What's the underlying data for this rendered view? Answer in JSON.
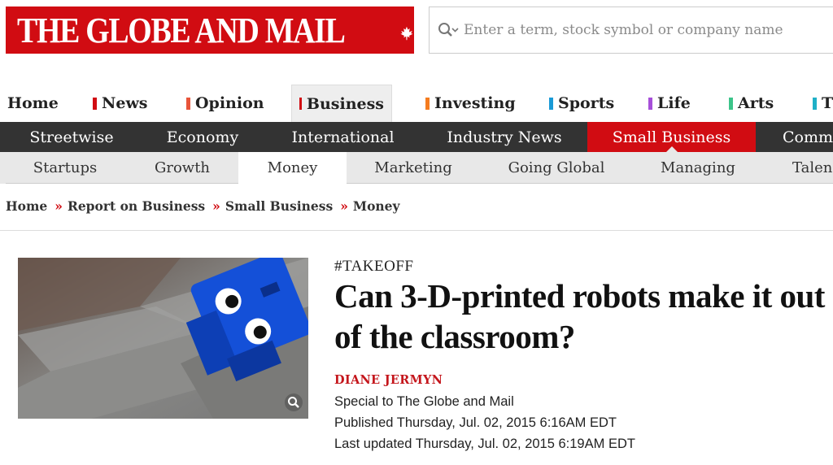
{
  "header": {
    "logo_text": "THE GLOBE AND MAIL",
    "search_placeholder": "Enter a term, stock symbol or company name"
  },
  "primary_nav": [
    {
      "label": "Home",
      "color": ""
    },
    {
      "label": "News",
      "color": "#d10c12"
    },
    {
      "label": "Opinion",
      "color": "#e8543a"
    },
    {
      "label": "Business",
      "color": "#d10c12"
    },
    {
      "label": "Investing",
      "color": "#f57c1f"
    },
    {
      "label": "Sports",
      "color": "#1a9ad6"
    },
    {
      "label": "Life",
      "color": "#a64fd9"
    },
    {
      "label": "Arts",
      "color": "#3cc48a"
    },
    {
      "label": "T",
      "color": "#1fb0c7"
    }
  ],
  "secondary_nav": [
    "Streetwise",
    "Economy",
    "International",
    "Industry News",
    "Small Business",
    "Comm"
  ],
  "tertiary_nav": [
    "Startups",
    "Growth",
    "Money",
    "Marketing",
    "Going Global",
    "Managing",
    "Talen"
  ],
  "breadcrumb": [
    "Home",
    "Report on Business",
    "Small Business",
    "Money"
  ],
  "breadcrumb_sep": "»",
  "article": {
    "kicker": "#TAKEOFF",
    "headline": "Can 3-D-printed robots make it out of the classroom?",
    "author": "DIANE JERMYN",
    "special": "Special to The Globe and Mail",
    "published": "Published Thursday, Jul. 02, 2015 6:16AM EDT",
    "updated": "Last updated Thursday, Jul. 02, 2015 6:19AM EDT"
  },
  "colors": {
    "brand_red": "#d10c12",
    "dark_nav": "#333333",
    "light_nav": "#e8e8e8"
  }
}
